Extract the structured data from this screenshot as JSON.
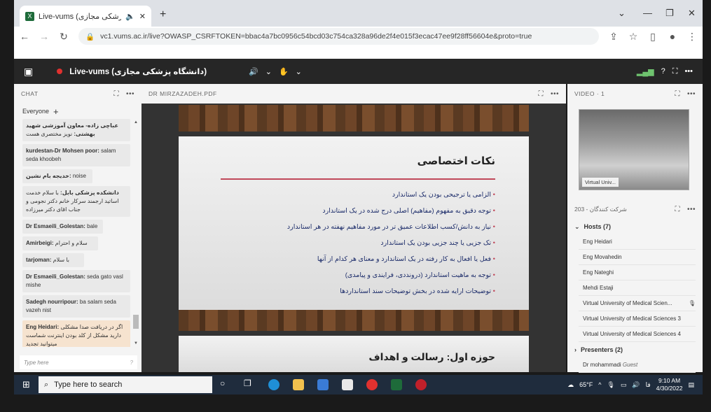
{
  "browser": {
    "tab_title": "Live-vums (دانشگاه پزشکی مجازی)",
    "tab_favicon": "X",
    "url": "vc1.vums.ac.ir/live?OWASP_CSRFTOKEN=bbac4a7bc0956c54bcd03c754ca328a96de2f4e015f3ecac47ee9f28ff56604e&proto=true"
  },
  "topbar": {
    "title": "Live-vums (دانشگاه پزشکی مجازی)"
  },
  "chat": {
    "header": "CHAT",
    "everyone": "Everyone",
    "placeholder": "Type here",
    "messages": [
      {
        "name": "عباچی زاده- معاون آموزشی شهید بهشتی:",
        "text": " نویز مختصری هست"
      },
      {
        "name": "kurdestan-Dr Mohsen poor:",
        "text": " salam seda khoobeh"
      },
      {
        "name": "خدیجه بام نشین:",
        "text": " noise"
      },
      {
        "name": "دانشکده پزشکی بابل:",
        "text": " با سلام خدمت اساتید ارجمند سرکار خانم دکتر نجومی و جناب اقای دکتر میرزاده"
      },
      {
        "name": "Dr Esmaeili_Golestan:",
        "text": " bale"
      },
      {
        "name": "Amirbeigi:",
        "text": " سلام و احترام"
      },
      {
        "name": "tarjoman:",
        "text": " با سلام"
      },
      {
        "name": "Dr Esmaeili_Golestan:",
        "text": " seda gato vasl mishe"
      },
      {
        "name": "Sadegh nourripour:",
        "text": " ba salam seda vazeh nist"
      },
      {
        "name": "Eng Heidari:",
        "text": " اگر در دریافت صدا مشکلی دارید مشکل از کلد بودن اینترنت شماست میتوانید تجدید"
      }
    ]
  },
  "pdf": {
    "header": "DR MIRZAZADEH.PDF",
    "slide1": {
      "title": "نکات اختصاصی",
      "bullets": [
        "الزامی یا ترجیحی بودن یک استاندارد",
        "توجه دقیق به مفهوم (مفاهیم) اصلی درج شده در یک استاندارد",
        "نیاز به دانش/کسب اطلاعات عمیق تر در مورد مفاهیم نهفته در هر استاندارد",
        "تک جزیی یا چند جزیی بودن یک استاندارد",
        "فعل یا افعال به کار رفته در یک استاندارد و معنای هر کدام از آنها",
        "توجه به ماهیت استاندارد (درونددی، فرایندی و پیامدی)",
        "توضیحات ارایه شده در بخش توضیحات سند استانداردها"
      ]
    },
    "slide2": {
      "title": "حوزه اول: رسالت و اهداف"
    }
  },
  "video": {
    "header": "VIDEO",
    "count": "1",
    "label": "Virtual Univ..."
  },
  "participants": {
    "header": "شرکت کنندگان",
    "count": "203",
    "hosts_label": "Hosts (7)",
    "hosts": [
      "Eng Heidari",
      "Eng Movahedin",
      "Eng Nateghi",
      "Mehdi Estaji",
      "Virtual University of Medical Scien...",
      "Virtual University of Medical Sciences 3",
      "Virtual University of Medical Sciences 4"
    ],
    "presenters_label": "Presenters (2)",
    "presenters": [
      {
        "name": "Dr mohammadi",
        "role": "Guest"
      }
    ]
  },
  "taskbar": {
    "search": "Type here to search",
    "weather": "65°F",
    "lang": "فا",
    "time": "9:10 AM",
    "date": "4/30/2022"
  }
}
